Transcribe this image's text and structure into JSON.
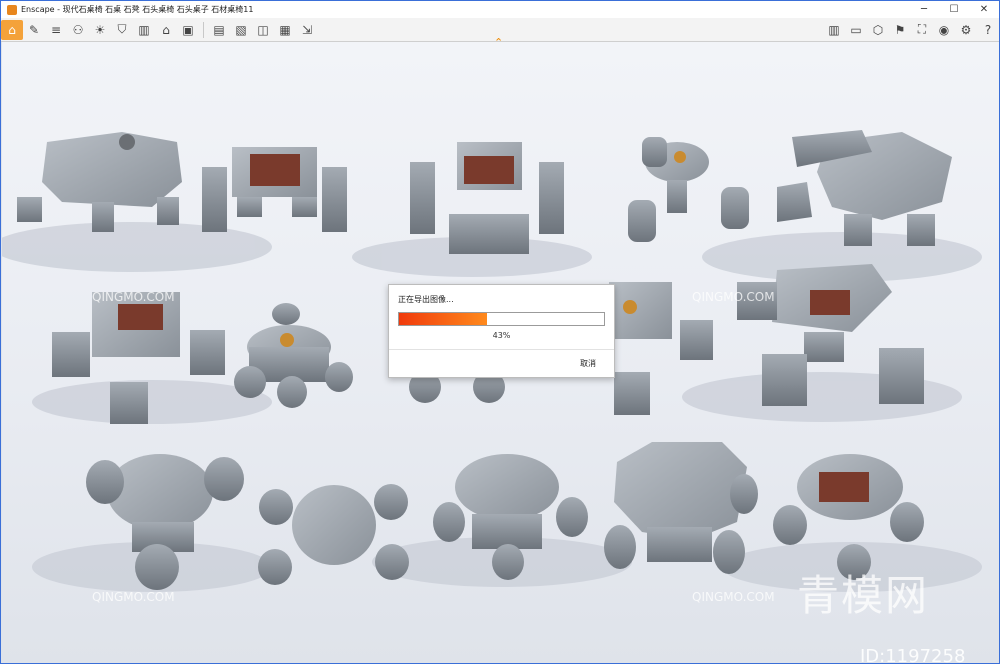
{
  "window": {
    "title": "Enscape - 现代石桌椅 石桌 石凳 石头桌椅 石头桌子 石材桌椅11"
  },
  "toolbar": {
    "left_icons": [
      "home-icon",
      "pin-icon",
      "list-icon",
      "gamepad-icon",
      "sun-icon",
      "shield-icon",
      "building-icon",
      "house-icon",
      "camera-icon",
      "screenshot-icon",
      "export-icon",
      "panorama-icon",
      "video-icon",
      "batch-icon"
    ],
    "right_icons": [
      "book-icon",
      "materials-icon",
      "asset-icon",
      "settings-icon",
      "capture-icon",
      "eye-icon",
      "gear-icon",
      "help-icon"
    ]
  },
  "dialog": {
    "title": "正在导出图像...",
    "progress": 43,
    "percent_text": "43%",
    "cancel_label": "取消"
  },
  "watermarks": {
    "brand": "青模网",
    "id": "ID:1197258",
    "site": "QINGMO.COM"
  }
}
